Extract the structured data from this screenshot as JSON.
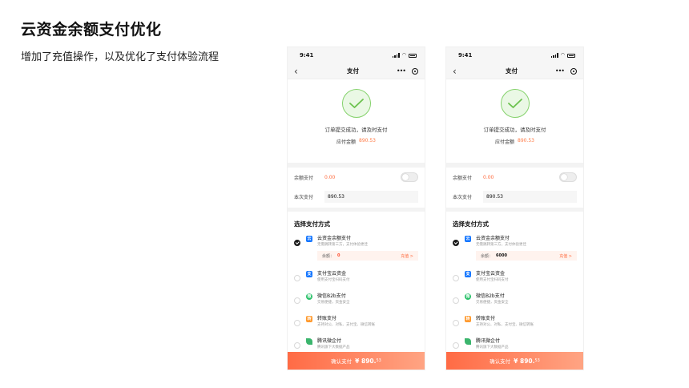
{
  "slide": {
    "title": "云资金余额支付优化",
    "subtitle": "增加了充值操作，以及优化了支付体验流程"
  },
  "colors": {
    "accent": "#ff6b45",
    "success": "#85d26c",
    "alipay": "#1677ff",
    "wechat": "#2bc16a",
    "transfer": "#ff9a2e",
    "tencent": "#3bb56d"
  },
  "phones": [
    {
      "status_time": "9:41",
      "nav_title": "支付",
      "success_text": "订单提交成功，请及时支付",
      "amount_label": "应付金额",
      "amount_value": "890.53",
      "balance_label": "余额支付",
      "balance_value": "0.00",
      "pay_now_label": "本次支付",
      "pay_now_value": "890.53",
      "section_title": "选择支付方式",
      "methods": [
        {
          "icon": "cloud-fund-icon",
          "name": "云资金余额支付",
          "desc": "无需跳转第三方，支付体验更佳",
          "balance_label": "余额：",
          "balance_value": "0",
          "recharge": "充值 >"
        },
        {
          "icon": "alipay-icon",
          "name": "支付宝云资金",
          "desc": "使用支付宝扫码支付"
        },
        {
          "icon": "wechat-icon",
          "name": "微信B2b支付",
          "desc": "交易便捷，资金安全"
        },
        {
          "icon": "transfer-icon",
          "name": "转账支付",
          "desc": "支持对公、对私、支付宝、微信转账"
        },
        {
          "icon": "tencent-icon",
          "name": "腾讯微企付",
          "desc": "腾讯旗下大数据产品"
        }
      ],
      "confirm_label": "确认支付",
      "confirm_amount": "¥ 890.",
      "confirm_cents": "53"
    },
    {
      "status_time": "9:41",
      "nav_title": "支付",
      "success_text": "订单提交成功，请及时支付",
      "amount_label": "应付金额",
      "amount_value": "890.53",
      "balance_label": "余额支付",
      "balance_value": "0.00",
      "pay_now_label": "本次支付",
      "pay_now_value": "890.53",
      "section_title": "选择支付方式",
      "methods": [
        {
          "icon": "cloud-fund-icon",
          "name": "云资金余额支付",
          "desc": "无需跳转第三方，支付体验更佳",
          "balance_label": "余额：",
          "balance_value": "6000",
          "recharge": "充值 >"
        },
        {
          "icon": "alipay-icon",
          "name": "支付宝云资金",
          "desc": "使用支付宝扫码支付"
        },
        {
          "icon": "wechat-icon",
          "name": "微信B2b支付",
          "desc": "交易便捷，资金安全"
        },
        {
          "icon": "transfer-icon",
          "name": "转账支付",
          "desc": "支持对公、对私、支付宝、微信转账"
        },
        {
          "icon": "tencent-icon",
          "name": "腾讯微企付",
          "desc": "腾讯旗下大数据产品"
        }
      ],
      "confirm_label": "确认支付",
      "confirm_amount": "¥ 890.",
      "confirm_cents": "53"
    }
  ]
}
